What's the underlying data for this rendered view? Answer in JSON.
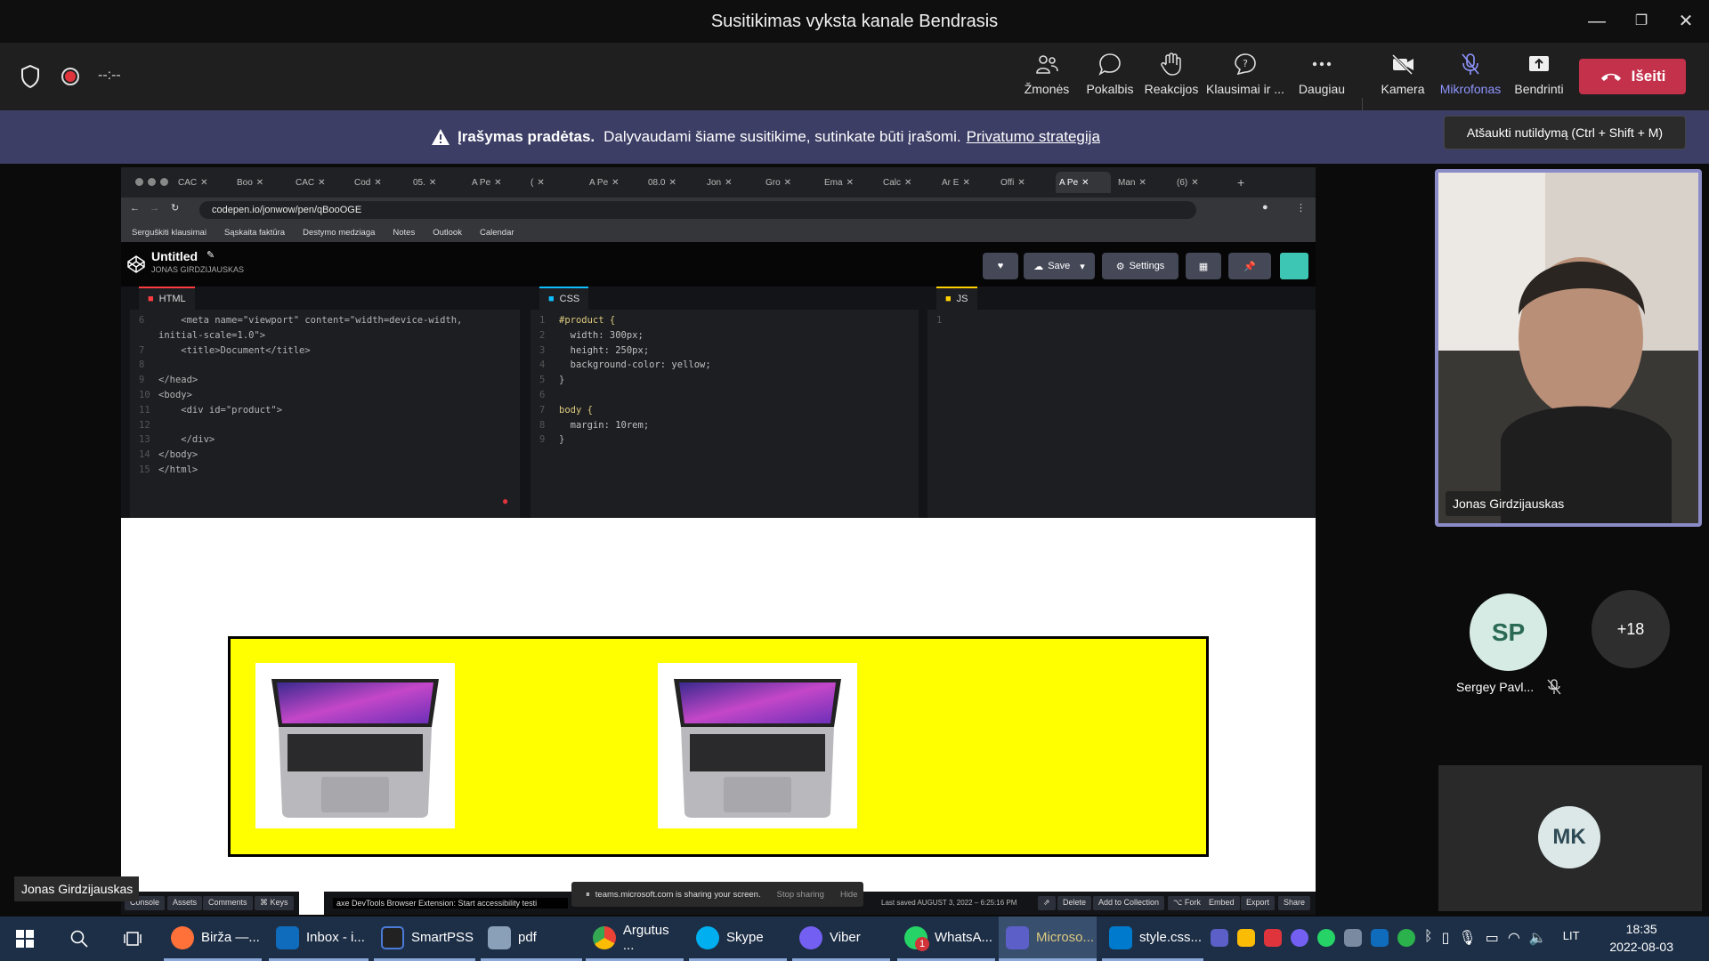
{
  "window": {
    "title": "Susitikimas vyksta kanale Bendrasis"
  },
  "meeting": {
    "timer": "--:--",
    "tools": [
      {
        "label": "Žmonės",
        "icon": "people-icon"
      },
      {
        "label": "Pokalbis",
        "icon": "chat-icon"
      },
      {
        "label": "Reakcijos",
        "icon": "raise-hand-icon"
      },
      {
        "label": "Klausimai ir ...",
        "icon": "questions-icon"
      },
      {
        "label": "Daugiau",
        "icon": "more-icon"
      },
      {
        "label": "Kamera",
        "icon": "camera-off-icon"
      },
      {
        "label": "Mikrofonas",
        "icon": "mic-off-icon"
      },
      {
        "label": "Bendrinti",
        "icon": "share-icon"
      }
    ],
    "leave_label": "Išeiti",
    "banner": {
      "title": "Įrašymas pradėtas.",
      "text": "Dalyvaudami šiame susitikime, sutinkate būti įrašomi.",
      "link": "Privatumo strategija"
    },
    "tooltip": "Atšaukti nutildymą (Ctrl + Shift + M)",
    "presenter_name": "Jonas Girdzijauskas",
    "self_name": "Jonas Girdzijauskas",
    "participants": [
      {
        "initials": "SP",
        "name": "Sergey Pavl...",
        "muted": true
      },
      {
        "initials": "+18"
      },
      {
        "initials": "MK"
      }
    ],
    "colors": {
      "banner": "#3d3e66",
      "leave": "#c4314b",
      "accent": "#8b8cc7"
    }
  },
  "browser": {
    "tabs": [
      "CAC",
      "Boo",
      "CAC",
      "Cod",
      "05.",
      "A Pe",
      "(",
      "A Pe",
      "08.0",
      "Jon",
      "Gro",
      "Ema",
      "Calc",
      "Ar E",
      "Offi",
      "A Pe",
      "Man",
      "(6)"
    ],
    "url": "codepen.io/jonwow/pen/qBooOGE",
    "bookmarks": [
      "Serguškiti klausimai",
      "Sąskaita faktūra",
      "Destymo medziaga",
      "Notes",
      "Outlook",
      "Calendar"
    ]
  },
  "codepen": {
    "pen_title": "Untitled",
    "author": "JONAS GIRDZIJAUSKAS",
    "save": "Save",
    "settings": "Settings",
    "panes": {
      "html": "HTML",
      "css": "CSS",
      "js": "JS"
    },
    "html_lines": [
      {
        "n": "6",
        "t": "    <meta name=\"viewport\" content=\"width=device-width,"
      },
      {
        "n": "",
        "t": "initial-scale=1.0\">"
      },
      {
        "n": "7",
        "t": "    <title>Document</title>"
      },
      {
        "n": "8",
        "t": ""
      },
      {
        "n": "9",
        "t": "</head>"
      },
      {
        "n": "10",
        "t": "<body>"
      },
      {
        "n": "11",
        "t": "    <div id=\"product\">"
      },
      {
        "n": "12",
        "t": ""
      },
      {
        "n": "13",
        "t": "    </div>"
      },
      {
        "n": "14",
        "t": "</body>"
      },
      {
        "n": "15",
        "t": "</html>"
      }
    ],
    "css_lines": [
      {
        "n": "1",
        "t": "#product {"
      },
      {
        "n": "2",
        "t": "  width: 300px;"
      },
      {
        "n": "3",
        "t": "  height: 250px;"
      },
      {
        "n": "4",
        "t": "  background-color: yellow;"
      },
      {
        "n": "5",
        "t": "}"
      },
      {
        "n": "6",
        "t": ""
      },
      {
        "n": "7",
        "t": "body {"
      },
      {
        "n": "8",
        "t": "  margin: 10rem;"
      },
      {
        "n": "9",
        "t": "}"
      }
    ],
    "js_lines": [
      {
        "n": "1",
        "t": ""
      }
    ],
    "preview_bg": "#ffff00",
    "footer": {
      "buttons": [
        "Console",
        "Assets",
        "Comments",
        "⌘ Keys"
      ],
      "axe": "axe DevTools Browser Extension: Start accessibility testi",
      "last_saved": "Last saved AUGUST 3, 2022 – 6:25:16 PM",
      "right_buttons": [
        "Delete",
        "Add to Collection",
        "⌥ Fork",
        "Embed",
        "Export",
        "Share"
      ]
    }
  },
  "share_bar": {
    "text": "teams.microsoft.com is sharing your screen.",
    "stop": "Stop sharing",
    "hide": "Hide"
  },
  "taskbar": {
    "apps": [
      {
        "label": "Birža —...",
        "color": "#ff7139"
      },
      {
        "label": "Inbox - i...",
        "color": "#0f6cbd"
      },
      {
        "label": "SmartPSS",
        "color": "#222"
      },
      {
        "label": "pdf",
        "color": "#555"
      },
      {
        "label": "Argutus ...",
        "color": "#34a853"
      },
      {
        "label": "Skype",
        "color": "#00aff0"
      },
      {
        "label": "Viber",
        "color": "#7360f2"
      },
      {
        "label": "WhatsA...",
        "color": "#25d366"
      },
      {
        "label": "Microso...",
        "color": "#5b5fc7"
      },
      {
        "label": "style.css...",
        "color": "#007acc"
      }
    ],
    "whatsapp_badge": "1",
    "lang": "LIT",
    "time": "18:35",
    "date": "2022-08-03"
  }
}
